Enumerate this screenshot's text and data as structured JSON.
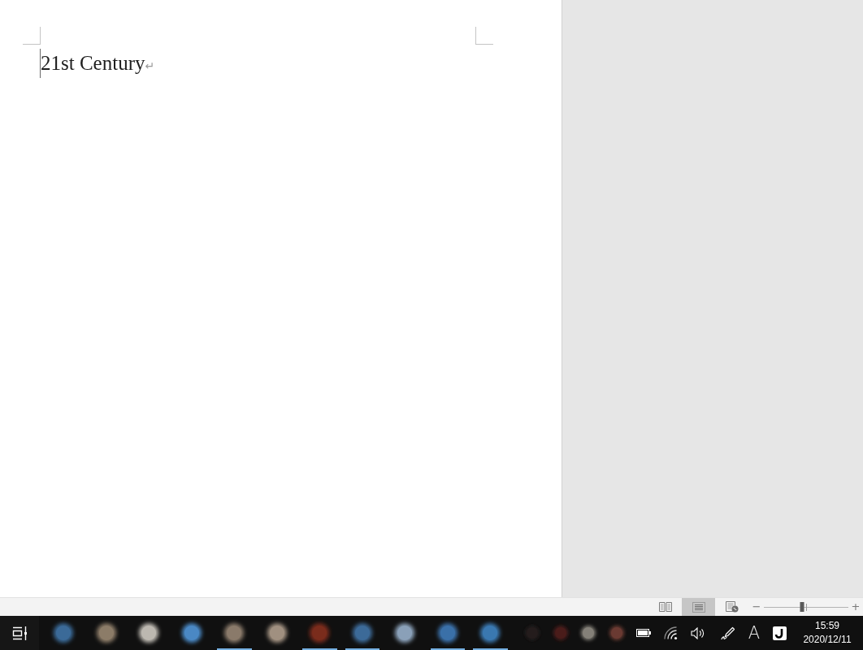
{
  "document": {
    "paragraphs": [
      {
        "text": "21st Century",
        "mark": "↵",
        "caret": true
      }
    ]
  },
  "status_bar": {
    "views": [
      {
        "kind": "read",
        "selected": false
      },
      {
        "kind": "print",
        "selected": true
      },
      {
        "kind": "web",
        "selected": false
      }
    ],
    "zoom": {
      "minus": "−",
      "plus": "+",
      "level": 0.45
    }
  },
  "taskbar": {
    "apps": [
      {
        "color": "#3b6a98",
        "running": false
      },
      {
        "color": "#8c7c68",
        "running": false
      },
      {
        "color": "#bcb8b0",
        "running": false
      },
      {
        "color": "#4a88c4",
        "running": false
      },
      {
        "color": "#8a7a6a",
        "running": true
      },
      {
        "color": "#a09080",
        "running": false
      },
      {
        "color": "#7a2c1c",
        "running": true
      },
      {
        "color": "#3c6a98",
        "running": true
      },
      {
        "color": "#8aa0b8",
        "running": false
      },
      {
        "color": "#3a70a8",
        "running": true
      },
      {
        "color": "#3a78b0",
        "running": true
      }
    ],
    "notification_icons": [
      {
        "color": "#241c1c"
      },
      {
        "color": "#4a1c1a"
      },
      {
        "color": "#848078"
      },
      {
        "color": "#6a3a32"
      }
    ],
    "ime": "A",
    "clock": {
      "time": "15:59",
      "date": "2020/12/11"
    }
  }
}
